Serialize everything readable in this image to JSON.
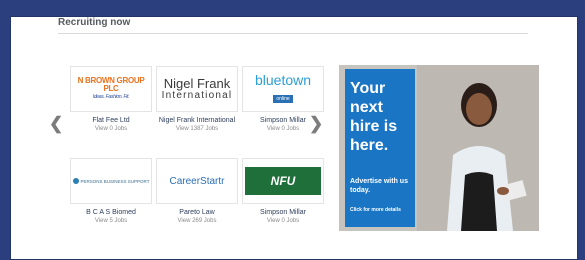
{
  "section": {
    "title": "Recruiting now"
  },
  "carousel": {
    "prev_icon": "chevron-left-icon",
    "next_icon": "chevron-right-icon",
    "cards": [
      {
        "logo_text": "N BROWN GROUP PLC",
        "logo_tagline": "Ideas. Fashion. Fit.",
        "name": "Flat Fee Ltd",
        "jobs": "View 0 Jobs"
      },
      {
        "logo_text": "Nigel Frank",
        "logo_sub": "International",
        "name": "Nigel Frank International",
        "jobs": "View 1387 Jobs"
      },
      {
        "logo_text": "bluetown",
        "logo_sub": "online",
        "name": "Simpson Millar",
        "jobs": "View 0 Jobs"
      },
      {
        "logo_text": "PERSONS BUSINESS SUPPORT",
        "name": "B C A S Biomed",
        "jobs": "View 5 Jobs"
      },
      {
        "logo_text": "CareerStartr",
        "name": "Pareto Law",
        "jobs": "View 269 Jobs"
      },
      {
        "logo_text": "NFU",
        "name": "Simpson Millar",
        "jobs": "View 0 Jobs"
      }
    ]
  },
  "ad": {
    "headline": "Your next hire is here.",
    "sub": "Advertise with us today.",
    "cta": "Click for more details",
    "accent": "#1a75c4"
  }
}
